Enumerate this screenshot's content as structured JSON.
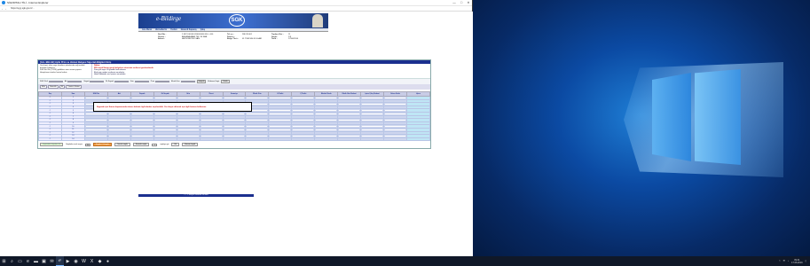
{
  "browser": {
    "title": "SİGORTALI TİLİ - Internet Explorer",
    "url": "https://uyg.sgk.gov.tr/...",
    "controls": [
      "—",
      "□",
      "✕"
    ]
  },
  "page": {
    "brand": "e-Bildirge",
    "logo": "SGK",
    "menu": [
      "Ana Menü",
      "Hizmetlerim",
      "Yardım",
      "Güvenli Kapanış",
      "Çıkış"
    ],
    "info": [
      {
        "label": "Sicil No :",
        "value": "2 0321 08 08 0110001000 010 - 000"
      },
      {
        "label": "Tel no :",
        "value": "286 39 401"
      },
      {
        "label": "Toplam Kişi :",
        "value": "11"
      },
      {
        "label": "Ünvanı :",
        "value": "ANKARA ABAK TEL VE KAB."
      },
      {
        "label": "Dönem :",
        "value": ""
      },
      {
        "label": "Sayfa :",
        "value": "1/3"
      },
      {
        "label": "Adresi :",
        "value": "HEPSİ BÜYÜK SAN."
      },
      {
        "label": "Belge Türü :",
        "value": "01 TÜM SİG.KOLLARI"
      },
      {
        "label": "Tarih :",
        "value": "17/06/2016"
      }
    ],
    "form_title": "[ALL BELGE] Aylık Prim ve Hizmet Belgesi Sigortalı Bilgileri Giriş",
    "notes_left": [
      "Yeni kayıt, silme veya düzeltme işlemlerinde sağ taraftaki butonları kullanınız.",
      "SGK Sicil No (TCKN) girildikten sonra arama yapınız.",
      "Hesaplanan tutarları kontrol ediniz."
    ],
    "notes_right_title": "Dikkat:",
    "notes_right": [
      "5510 sayılı Kanun gereği belgelerin süresinde verilmesi gerekmektedir.",
      "Prim gün sayısı 30 günden fazla olamaz.",
      "Eksik gün nedeni seçilmesi zorunludur.",
      "Hatalı bildirimler için işveren sorumludur."
    ],
    "search": {
      "fields": [
        "SGK Sicil",
        "Ad",
        "Soyad",
        "İlk Soyad",
        "Gün",
        "Prim",
        "Eksik Gün"
      ],
      "button": "Sorgula",
      "extra_label": "Eklenen Kayıt",
      "extra_button": "Yenile"
    },
    "tabs": [
      "Ekle",
      "Güncelle",
      "Sil",
      "Tümünü Göster"
    ],
    "alert": "Sigortalı için Kanun kapsamında olması halinde ilgili alanlar seçilmelidir. Yeni kayıt eklemek için ilgili butonu kullanınız.",
    "columns": [
      "Seç",
      "Sıra",
      "SGK No",
      "Adı",
      "Soyadı",
      "İlk Soyadı",
      "Gün",
      "Ücret",
      "İkramiye",
      "Eksik Gün",
      "G.Tarihi",
      "Ç.Tarihi",
      "Meslek Kodu",
      "Eksik Gün Nedeni",
      "İşten Çıkış Nedeni",
      "Görev Kodu",
      "İşlem"
    ],
    "rows": [
      "1",
      "2",
      "3",
      "4",
      "5",
      "6",
      "7",
      "8",
      "9",
      "10",
      "11",
      "12",
      "13",
      "14"
    ],
    "bottom": {
      "reset_button": "Sayfadaki Kayıtları Sil",
      "page_label": "Sayfada sıralı sayısı",
      "page_value": "20",
      "confirm_button": "Kaydet / Onayla",
      "prev_button": "Önceki sayfa",
      "next_button": "Sonraki sayfa",
      "go_label": "sayfaya git",
      "go_value": "1",
      "goto_button": "Git",
      "last_button": "Dönem kaydı"
    },
    "footer": "© T.C.Sosyal Güvenlik Kurumu"
  },
  "taskbar": {
    "items": [
      "start-icon",
      "search-icon",
      "task-view-icon",
      "edge-icon",
      "explorer-icon",
      "store-icon",
      "mail-icon",
      "ie-icon",
      "media-icon",
      "firefox-icon",
      "word-icon",
      "excel-icon",
      "pdf-icon",
      "app-icon"
    ],
    "time": "09:41",
    "date": "17.06.2016"
  }
}
